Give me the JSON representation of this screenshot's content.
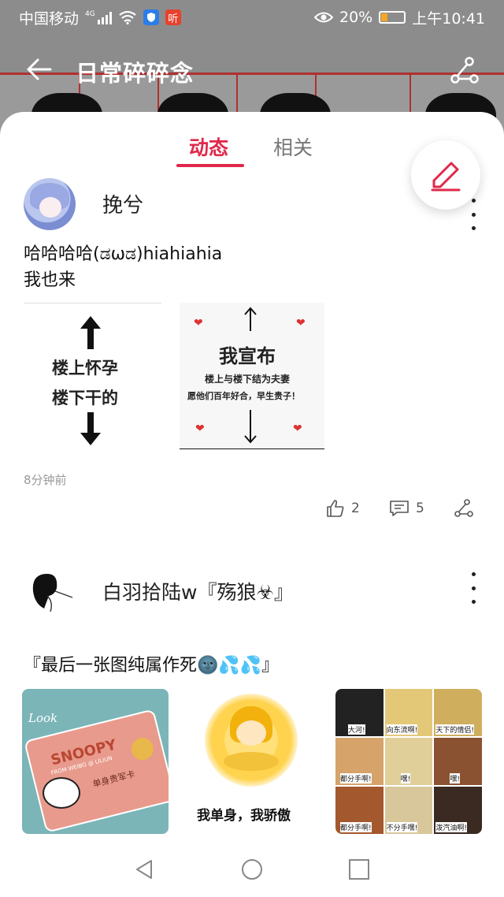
{
  "status_bar": {
    "carrier": "中国移动",
    "network": "4G",
    "listen_badge": "听",
    "battery_percent": "20%",
    "time": "上午10:41"
  },
  "header": {
    "title": "日常碎碎念"
  },
  "tabs": [
    {
      "label": "动态",
      "active": true
    },
    {
      "label": "相关",
      "active": false
    }
  ],
  "posts": [
    {
      "username": "挽兮",
      "text_lines": [
        "哈哈哈哈(ಡωಡ)hiahiahia",
        "我也来"
      ],
      "images": [
        {
          "lines": [
            "楼上怀孕",
            "楼下干的"
          ]
        },
        {
          "title": "我宣布",
          "lines": [
            "楼上与楼下结为夫妻",
            "愿他们百年好合，早生贵子！"
          ]
        }
      ],
      "time": "8分钟前",
      "likes": "2",
      "comments": "5"
    },
    {
      "username": "白羽拾陆w『殇狼☣』",
      "text": "『最后一张图纯属作死🌚💦💦』",
      "images": [
        {
          "look": "Look",
          "brand": "SNOOPY",
          "sub": "FROM WEIBO @ LILIUN",
          "card_text": "单身贵军卡"
        },
        {
          "caption": "我单身，我骄傲"
        },
        {
          "cells": [
            "大河!",
            "向东流啊!",
            "天下的情侣!",
            "都分手啊!",
            "嘿!",
            "嘿!",
            "都分手啊!",
            "不分手嘿!",
            "泼汽油啊!"
          ]
        }
      ]
    }
  ],
  "colors": {
    "accent": "#e0284a",
    "header_bg": "#8c8c8c"
  }
}
